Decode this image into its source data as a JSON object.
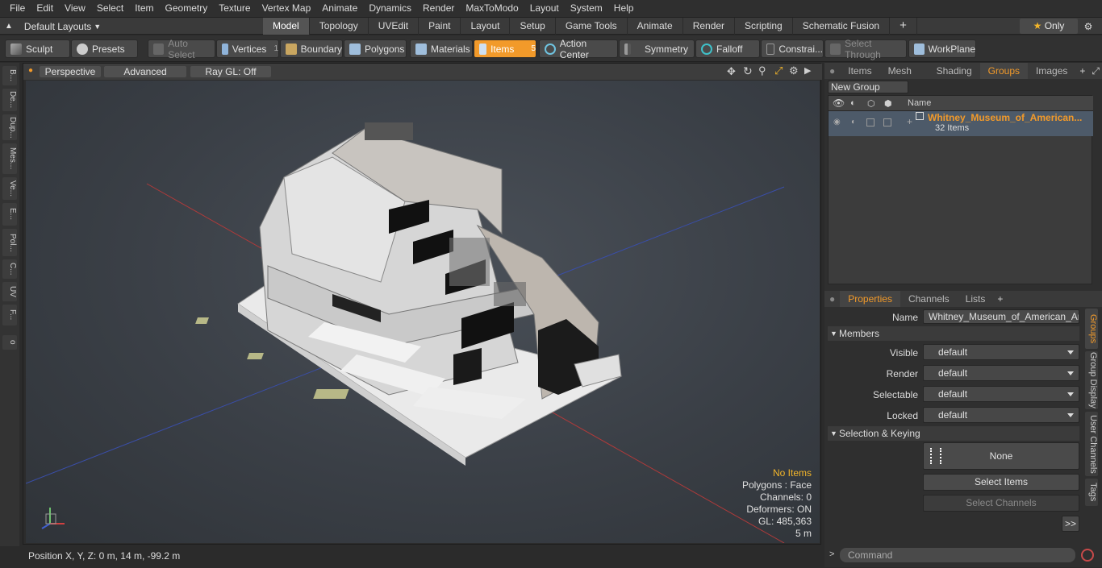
{
  "menu": [
    "File",
    "Edit",
    "View",
    "Select",
    "Item",
    "Geometry",
    "Texture",
    "Vertex Map",
    "Animate",
    "Dynamics",
    "Render",
    "MaxToModo",
    "Layout",
    "System",
    "Help"
  ],
  "layouts_label": "Default Layouts",
  "mode_tabs": [
    "Model",
    "Topology",
    "UVEdit",
    "Paint",
    "Layout",
    "Setup",
    "Game Tools",
    "Animate",
    "Render",
    "Scripting",
    "Schematic Fusion"
  ],
  "only_label": "Only",
  "toolbar": {
    "sculpt": "Sculpt",
    "presets": "Presets",
    "auto_select": "Auto Select",
    "vertices": "Vertices",
    "vertices_count": "1",
    "boundary": "Boundary",
    "polygons": "Polygons",
    "materials": "Materials",
    "items": "Items",
    "items_count": "5",
    "action_center": "Action Center",
    "symmetry": "Symmetry",
    "falloff": "Falloff",
    "constraints": "Constrai...",
    "select_through": "Select Through",
    "workplane": "WorkPlane"
  },
  "left_tabs": [
    "B...",
    "De...",
    "Dup...",
    "Mes...",
    "Ve...",
    "E...",
    "Pol...",
    "C...",
    "UV",
    "F..."
  ],
  "viewport": {
    "perspective": "Perspective",
    "advanced": "Advanced",
    "raygl": "Ray GL: Off",
    "info": {
      "items": "No Items",
      "polygons": "Polygons : Face",
      "channels": "Channels: 0",
      "deformers": "Deformers: ON",
      "gl": "GL: 485,363",
      "scale": "5 m"
    }
  },
  "status": "Position X, Y, Z:   0 m, 14 m, -99.2 m",
  "right": {
    "tabs": [
      "Items",
      "Mesh ...",
      "Shading",
      "Groups",
      "Images"
    ],
    "new_group": "New Group",
    "col_name": "Name",
    "group_name": "Whitney_Museum_of_American...",
    "group_count": "32 Items",
    "prop_tabs": [
      "Properties",
      "Channels",
      "Lists"
    ],
    "name_label": "Name",
    "name_value": "Whitney_Museum_of_American_Art (",
    "members": "Members",
    "visible_label": "Visible",
    "render_label": "Render",
    "selectable_label": "Selectable",
    "locked_label": "Locked",
    "default_value": "default",
    "sel_keying": "Selection & Keying",
    "none": "None",
    "select_items": "Select Items",
    "select_channels": "Select Channels",
    "more": ">>",
    "side_tabs": [
      "Groups",
      "Group Display",
      "User Channels",
      "Tags"
    ],
    "command_placeholder": "Command"
  },
  "colors": {
    "accent": "#f29a2a",
    "selection": "#4d5a69"
  }
}
